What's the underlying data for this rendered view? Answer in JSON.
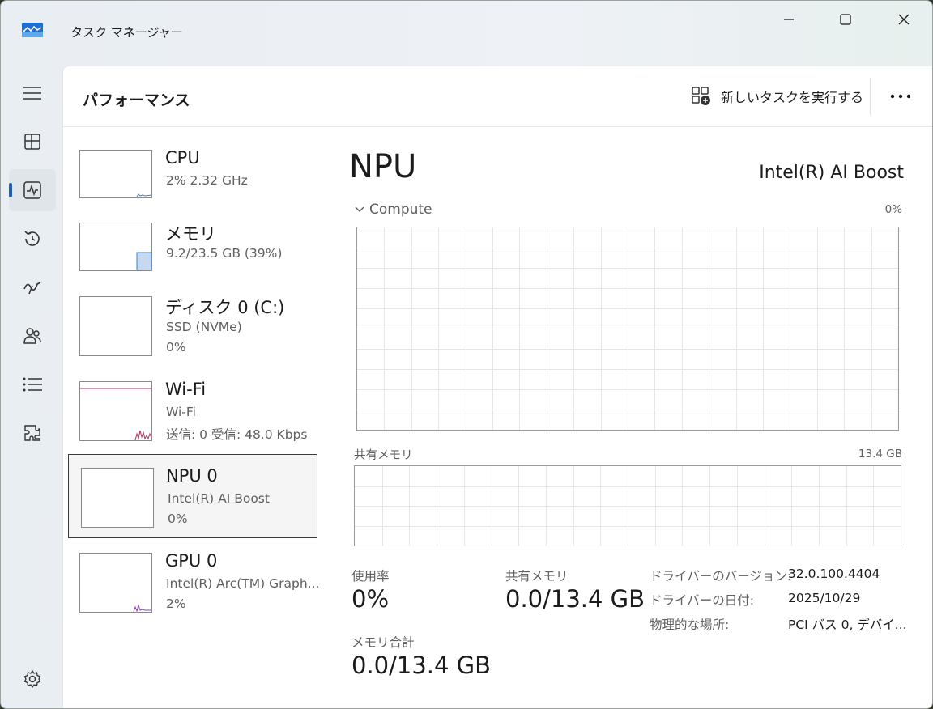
{
  "window": {
    "title": "タスク マネージャー"
  },
  "header": {
    "page_title": "パフォーマンス",
    "run_task_label": "新しいタスクを実行する"
  },
  "nav": {
    "icons": [
      "hamburger-icon",
      "processes-icon",
      "performance-icon",
      "app-history-icon",
      "startup-apps-icon",
      "users-icon",
      "details-icon",
      "services-icon",
      "settings-icon"
    ]
  },
  "resources": [
    {
      "name": "CPU",
      "line1": "2%  2.32 GHz",
      "line2": ""
    },
    {
      "name": "メモリ",
      "line1": "9.2/23.5 GB (39%)",
      "line2": ""
    },
    {
      "name": "ディスク 0 (C:)",
      "line1": "SSD (NVMe)",
      "line2": "0%"
    },
    {
      "name": "Wi-Fi",
      "line1": "Wi-Fi",
      "line2": "送信: 0  受信: 48.0 Kbps"
    },
    {
      "name": "NPU 0",
      "line1": "Intel(R) AI Boost",
      "line2": "0%"
    },
    {
      "name": "GPU 0",
      "line1": "Intel(R) Arc(TM) Graph...",
      "line2": "2%"
    }
  ],
  "detail": {
    "title": "NPU",
    "device_name": "Intel(R) AI Boost",
    "compute_label": "Compute",
    "compute_max": "0%",
    "shared_mem_label": "共有メモリ",
    "shared_mem_max": "13.4 GB",
    "stats": {
      "usage_label": "使用率",
      "usage_value": "0%",
      "shared_label": "共有メモリ",
      "shared_value": "0.0/13.4 GB",
      "total_label": "メモリ合計",
      "total_value": "0.0/13.4 GB"
    },
    "props": [
      {
        "label": "ドライバーのバージョン:",
        "value": "32.0.100.4404"
      },
      {
        "label": "ドライバーの日付:",
        "value": "2025/10/29"
      },
      {
        "label": "物理的な場所:",
        "value": "PCI バス 0, デバイ..."
      }
    ]
  },
  "colors": {
    "accent": "#1f5fb8",
    "cpu_line": "#3d7fd1",
    "memory_fill": "#c5d9f1",
    "wifi_line": "#a8345b",
    "gpu_line": "#8b3fc4"
  }
}
